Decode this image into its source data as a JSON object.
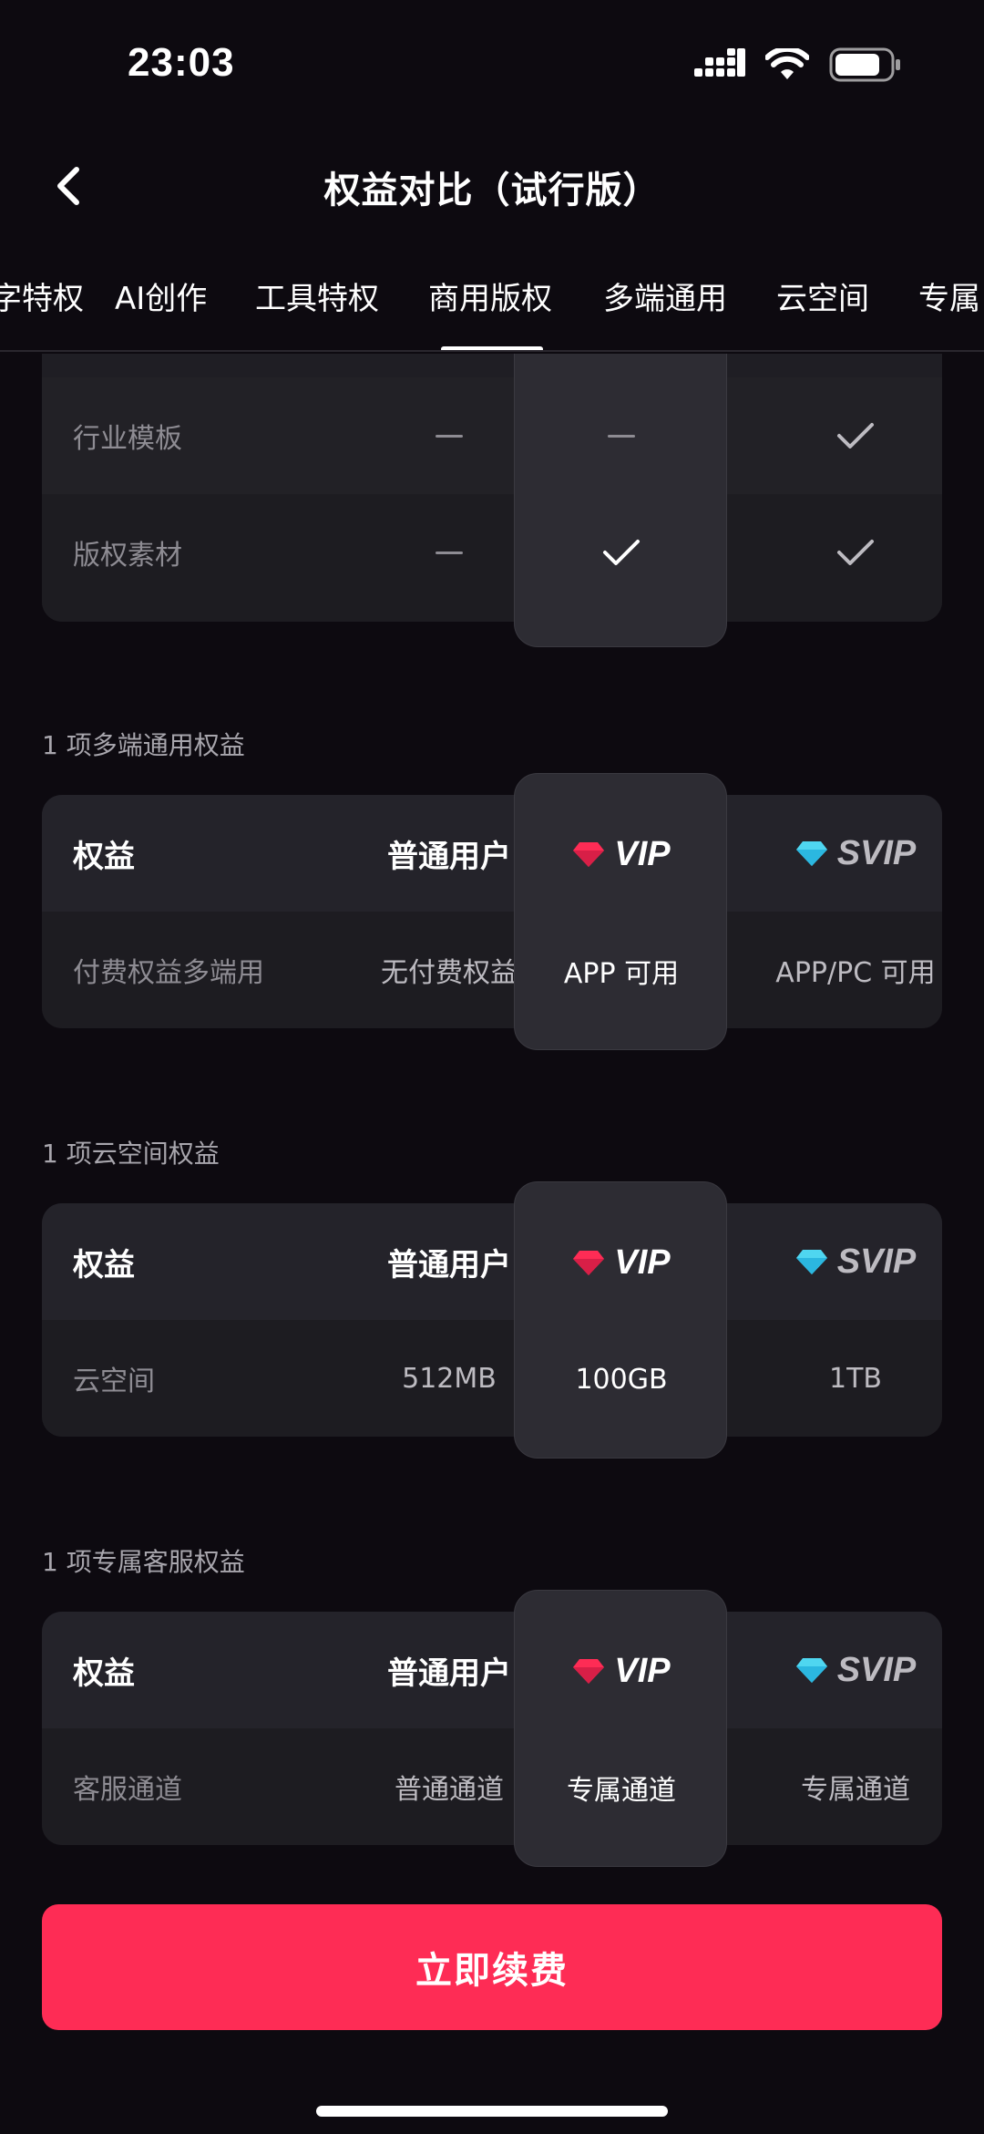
{
  "status_bar": {
    "time": "23:03",
    "icons": [
      "signal-icon",
      "wifi-icon",
      "battery-icon"
    ]
  },
  "nav": {
    "title": "权益对比（试行版）",
    "back_icon": "chevron-left-icon"
  },
  "tabs": {
    "items": [
      "字特权",
      "AI创作",
      "工具特权",
      "商用版权",
      "多端通用",
      "云空间",
      "专属"
    ],
    "active": "商用版权"
  },
  "columns": {
    "label": "权益",
    "free": "普通用户",
    "vip": "VIP",
    "svip": "SVIP"
  },
  "commercial": {
    "rows": [
      {
        "label": "行业模板",
        "free": "none",
        "vip": "none",
        "svip": "check"
      },
      {
        "label": "版权素材",
        "free": "none",
        "vip": "check",
        "svip": "check"
      }
    ]
  },
  "multi_device": {
    "title": "1 项多端通用权益",
    "rows": [
      {
        "label": "付费权益多端用",
        "free": "无付费权益",
        "vip": "APP 可用",
        "svip": "APP/PC 可用"
      }
    ]
  },
  "cloud": {
    "title": "1 项云空间权益",
    "rows": [
      {
        "label": "云空间",
        "free": "512MB",
        "vip": "100GB",
        "svip": "1TB"
      }
    ]
  },
  "service": {
    "title": "1 项专属客服权益",
    "rows": [
      {
        "label": "客服通道",
        "free": "普通通道",
        "vip": "专属通道",
        "svip": "专属通道"
      }
    ]
  },
  "cta": {
    "label": "立即续费"
  },
  "colors": {
    "background": "#0d0a10",
    "accent": "#fe2c55",
    "vip_gem": "#fe2c55",
    "svip_gem": "#4fd6f0"
  }
}
